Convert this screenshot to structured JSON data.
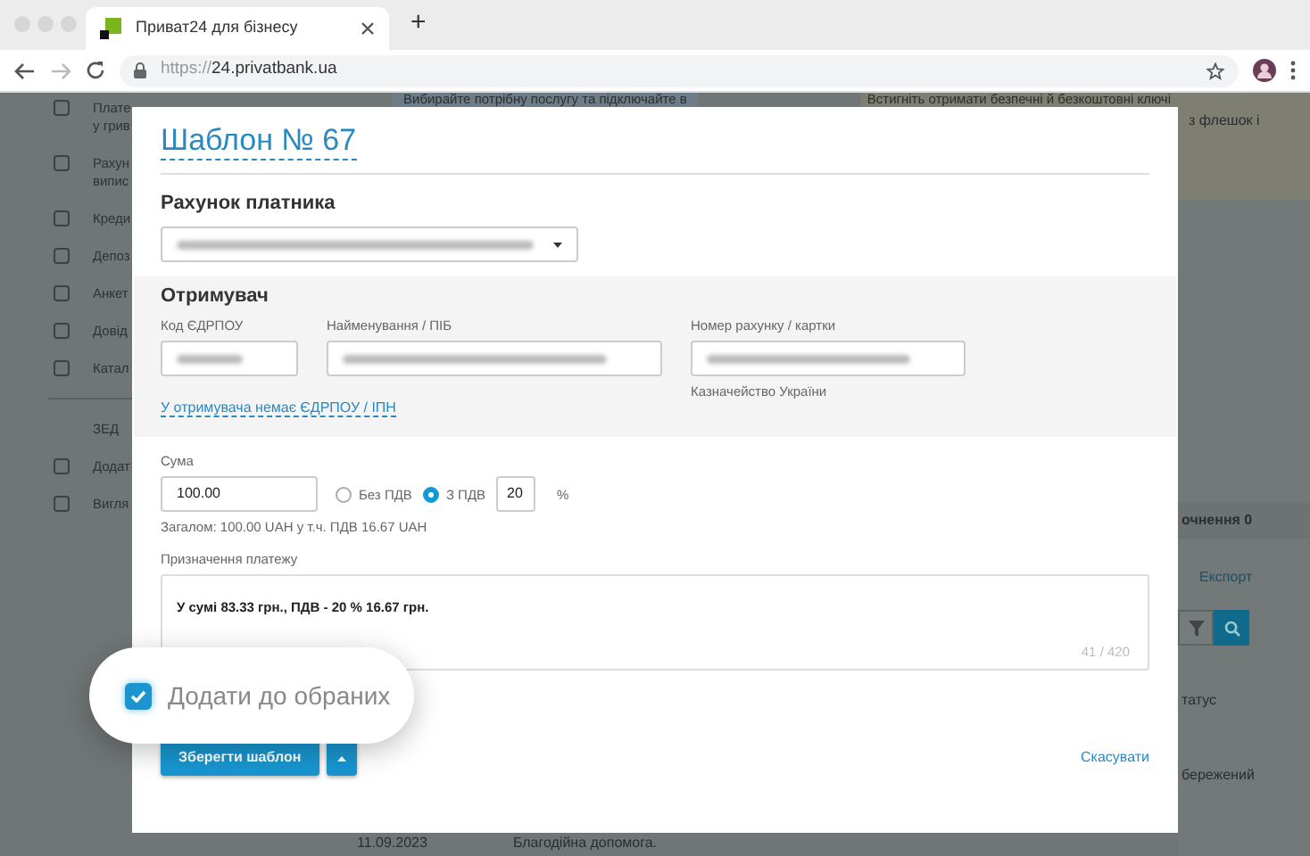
{
  "browser": {
    "tab_title": "Приват24 для бізнесу",
    "new_tab": "+",
    "url_scheme": "https://",
    "url_host": "24.privatbank.ua"
  },
  "background": {
    "sidebar": [
      {
        "lines": [
          "Плате",
          "у грив"
        ]
      },
      {
        "lines": [
          "Рахун",
          "випис"
        ]
      },
      {
        "lines": [
          "Креди"
        ]
      },
      {
        "lines": [
          "Депоз"
        ]
      },
      {
        "lines": [
          "Анкет"
        ]
      },
      {
        "lines": [
          "Довід"
        ]
      },
      {
        "lines": [
          "Катал"
        ]
      }
    ],
    "section": "ЗЕД",
    "sidebar_bottom": [
      {
        "lines": [
          "Додат"
        ]
      },
      {
        "lines": [
          "Вигля"
        ]
      }
    ],
    "banner_left": "Вибирайте потрібну послугу та підключайте в",
    "banner_right": "Встигніть отримати безпечні й безкоштовні ключі",
    "banner_right_more": "з флешок і",
    "count_label": "очнення 0",
    "export": "Експорт",
    "column_status": "татус",
    "row_status": "бережений",
    "bottom_date": "11.09.2023",
    "bottom_text": "Благодійна допомога."
  },
  "modal": {
    "title": "Шаблон № 67",
    "payer_heading": "Рахунок платника",
    "recipient_heading": "Отримувач",
    "fields": [
      {
        "label": "Код ЄДРПОУ"
      },
      {
        "label": "Найменування / ПІБ"
      },
      {
        "label": "Номер рахунку / картки",
        "note": "Казначейство України"
      }
    ],
    "no_code_link": "У отримувача немає ЄДРПОУ / ІПН",
    "amount_label": "Сума",
    "amount": "100.00",
    "vat_options": [
      {
        "label": "Без ПДВ",
        "selected": false
      },
      {
        "label": "З ПДВ",
        "selected": true
      }
    ],
    "vat_rate": "20",
    "percent": "%",
    "total": "Загалом:  100.00 UAH  у т.ч. ПДВ 16.67 UAH",
    "purpose_label": "Призначення платежу",
    "purpose": "У сумі 83.33 грн., ПДВ - 20 % 16.67 грн.",
    "counter": "41 / 420",
    "favorite": {
      "label": "Додати до обраних",
      "checked": true
    },
    "save": "Зберегти шаблон",
    "cancel": "Скасувати"
  }
}
